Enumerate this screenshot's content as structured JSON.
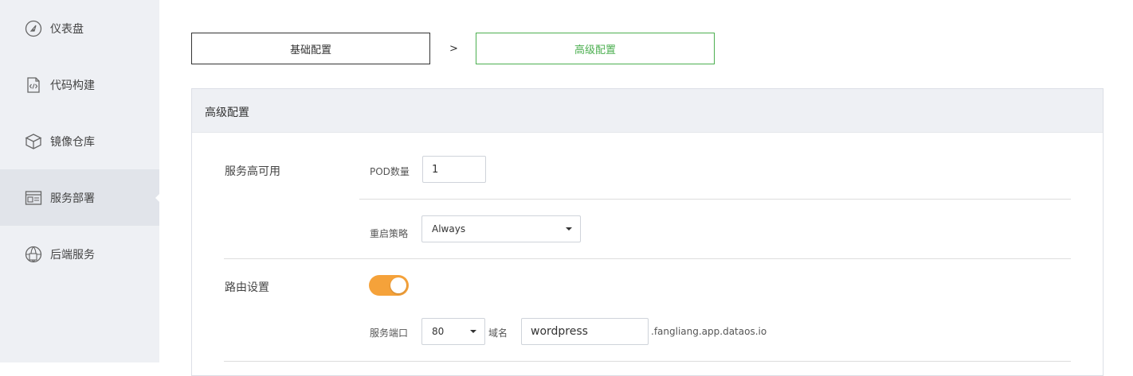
{
  "sidebar": {
    "items": [
      {
        "label": "仪表盘",
        "icon": "dashboard-icon"
      },
      {
        "label": "代码构建",
        "icon": "code-file-icon"
      },
      {
        "label": "镜像仓库",
        "icon": "box-icon"
      },
      {
        "label": "服务部署",
        "icon": "deploy-window-icon",
        "active": true
      },
      {
        "label": "后端服务",
        "icon": "globe-server-icon"
      }
    ]
  },
  "steps": {
    "step1": "基础配置",
    "separator": ">",
    "step2": "高级配置"
  },
  "panel": {
    "title": "高级配置",
    "availability": {
      "label": "服务高可用",
      "pod_label": "POD数量",
      "pod_value": "1",
      "restart_label": "重启策略",
      "restart_value": "Always"
    },
    "routing": {
      "label": "路由设置",
      "enabled": true,
      "port_label": "服务端口",
      "port_value": "80",
      "domain_label": "域名",
      "domain_value": "wordpress",
      "domain_suffix": ".fangliang.app.dataos.io"
    }
  },
  "colors": {
    "accent_green": "#4caf50",
    "toggle_orange": "#f5a23a",
    "sidebar_bg": "#eef0f4"
  }
}
